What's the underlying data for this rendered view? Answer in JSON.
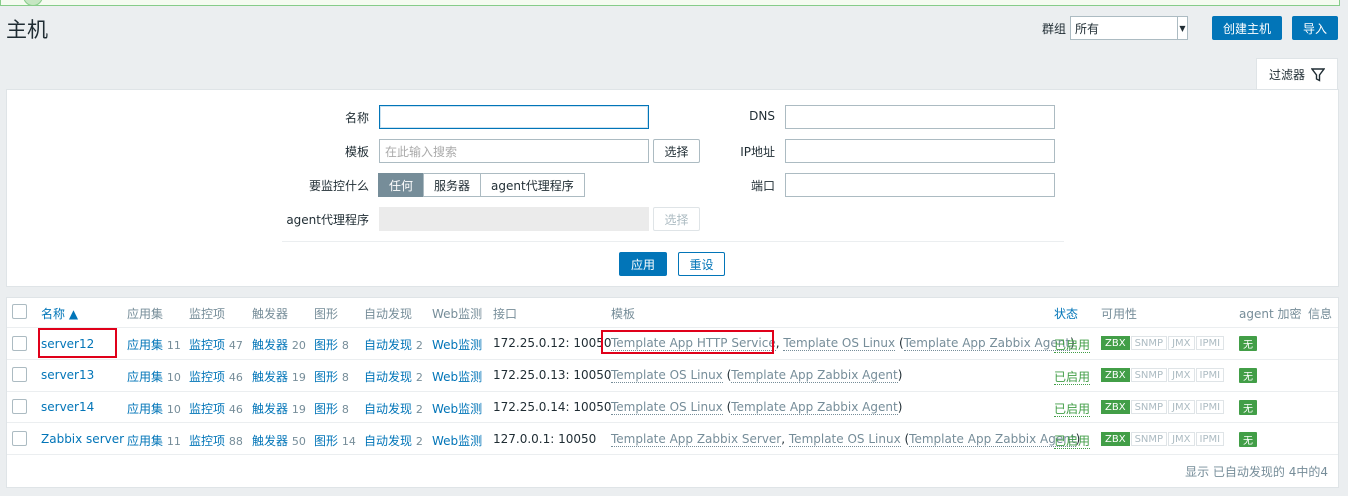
{
  "page": {
    "title": "主机"
  },
  "header": {
    "group_label": "群组",
    "group_value": "所有",
    "create_button": "创建主机",
    "import_button": "导入"
  },
  "filter": {
    "tab_label": "过滤器",
    "name_label": "名称",
    "name_value": "",
    "template_label": "模板",
    "template_placeholder": "在此输入搜索",
    "select_button": "选择",
    "monitored_by_label": "要监控什么",
    "monitored_by_options": [
      "任何",
      "服务器",
      "agent代理程序"
    ],
    "proxy_label": "agent代理程序",
    "proxy_select_button": "选择",
    "dns_label": "DNS",
    "ip_label": "IP地址",
    "port_label": "端口",
    "apply_button": "应用",
    "reset_button": "重设"
  },
  "table": {
    "headers": {
      "name": "名称 ▲",
      "applications": "应用集",
      "items": "监控项",
      "triggers": "触发器",
      "graphs": "图形",
      "discovery": "自动发现",
      "web": "Web监测",
      "interface": "接口",
      "templates": "模板",
      "status": "状态",
      "availability": "可用性",
      "encryption": "agent 加密",
      "info": "信息"
    },
    "rows": [
      {
        "name": "server12",
        "apps": "应用集",
        "apps_n": "11",
        "items": "监控项",
        "items_n": "47",
        "triggers": "触发器",
        "triggers_n": "20",
        "graphs": "图形",
        "graphs_n": "8",
        "disc": "自动发现",
        "disc_n": "2",
        "web": "Web监测",
        "iface": "172.25.0.12: 10050",
        "tpl1": "Template App HTTP Service",
        "tpl2": "Template OS Linux",
        "tpl3": "Template App Zabbix Agent",
        "status": "已启用",
        "enc": "无"
      },
      {
        "name": "server13",
        "apps": "应用集",
        "apps_n": "10",
        "items": "监控项",
        "items_n": "46",
        "triggers": "触发器",
        "triggers_n": "19",
        "graphs": "图形",
        "graphs_n": "8",
        "disc": "自动发现",
        "disc_n": "2",
        "web": "Web监测",
        "iface": "172.25.0.13: 10050",
        "tpl1": "Template OS Linux",
        "tpl3": "Template App Zabbix Agent",
        "status": "已启用",
        "enc": "无"
      },
      {
        "name": "server14",
        "apps": "应用集",
        "apps_n": "10",
        "items": "监控项",
        "items_n": "46",
        "triggers": "触发器",
        "triggers_n": "19",
        "graphs": "图形",
        "graphs_n": "8",
        "disc": "自动发现",
        "disc_n": "2",
        "web": "Web监测",
        "iface": "172.25.0.14: 10050",
        "tpl1": "Template OS Linux",
        "tpl3": "Template App Zabbix Agent",
        "status": "已启用",
        "enc": "无"
      },
      {
        "name": "Zabbix server",
        "apps": "应用集",
        "apps_n": "11",
        "items": "监控项",
        "items_n": "88",
        "triggers": "触发器",
        "triggers_n": "50",
        "graphs": "图形",
        "graphs_n": "14",
        "disc": "自动发现",
        "disc_n": "2",
        "web": "Web监测",
        "iface": "127.0.0.1: 10050",
        "tpl1": "Template App Zabbix Server",
        "tpl2": "Template OS Linux",
        "tpl3": "Template App Zabbix Agent",
        "status": "已启用",
        "enc": "无"
      }
    ],
    "availability_badges": [
      "ZBX",
      "SNMP",
      "JMX",
      "IPMI"
    ],
    "footer": "显示 已自动发现的 4中的4"
  },
  "colors": {
    "accent": "#0275b8",
    "enabled": "#429e47",
    "highlight": "#e0001a"
  }
}
